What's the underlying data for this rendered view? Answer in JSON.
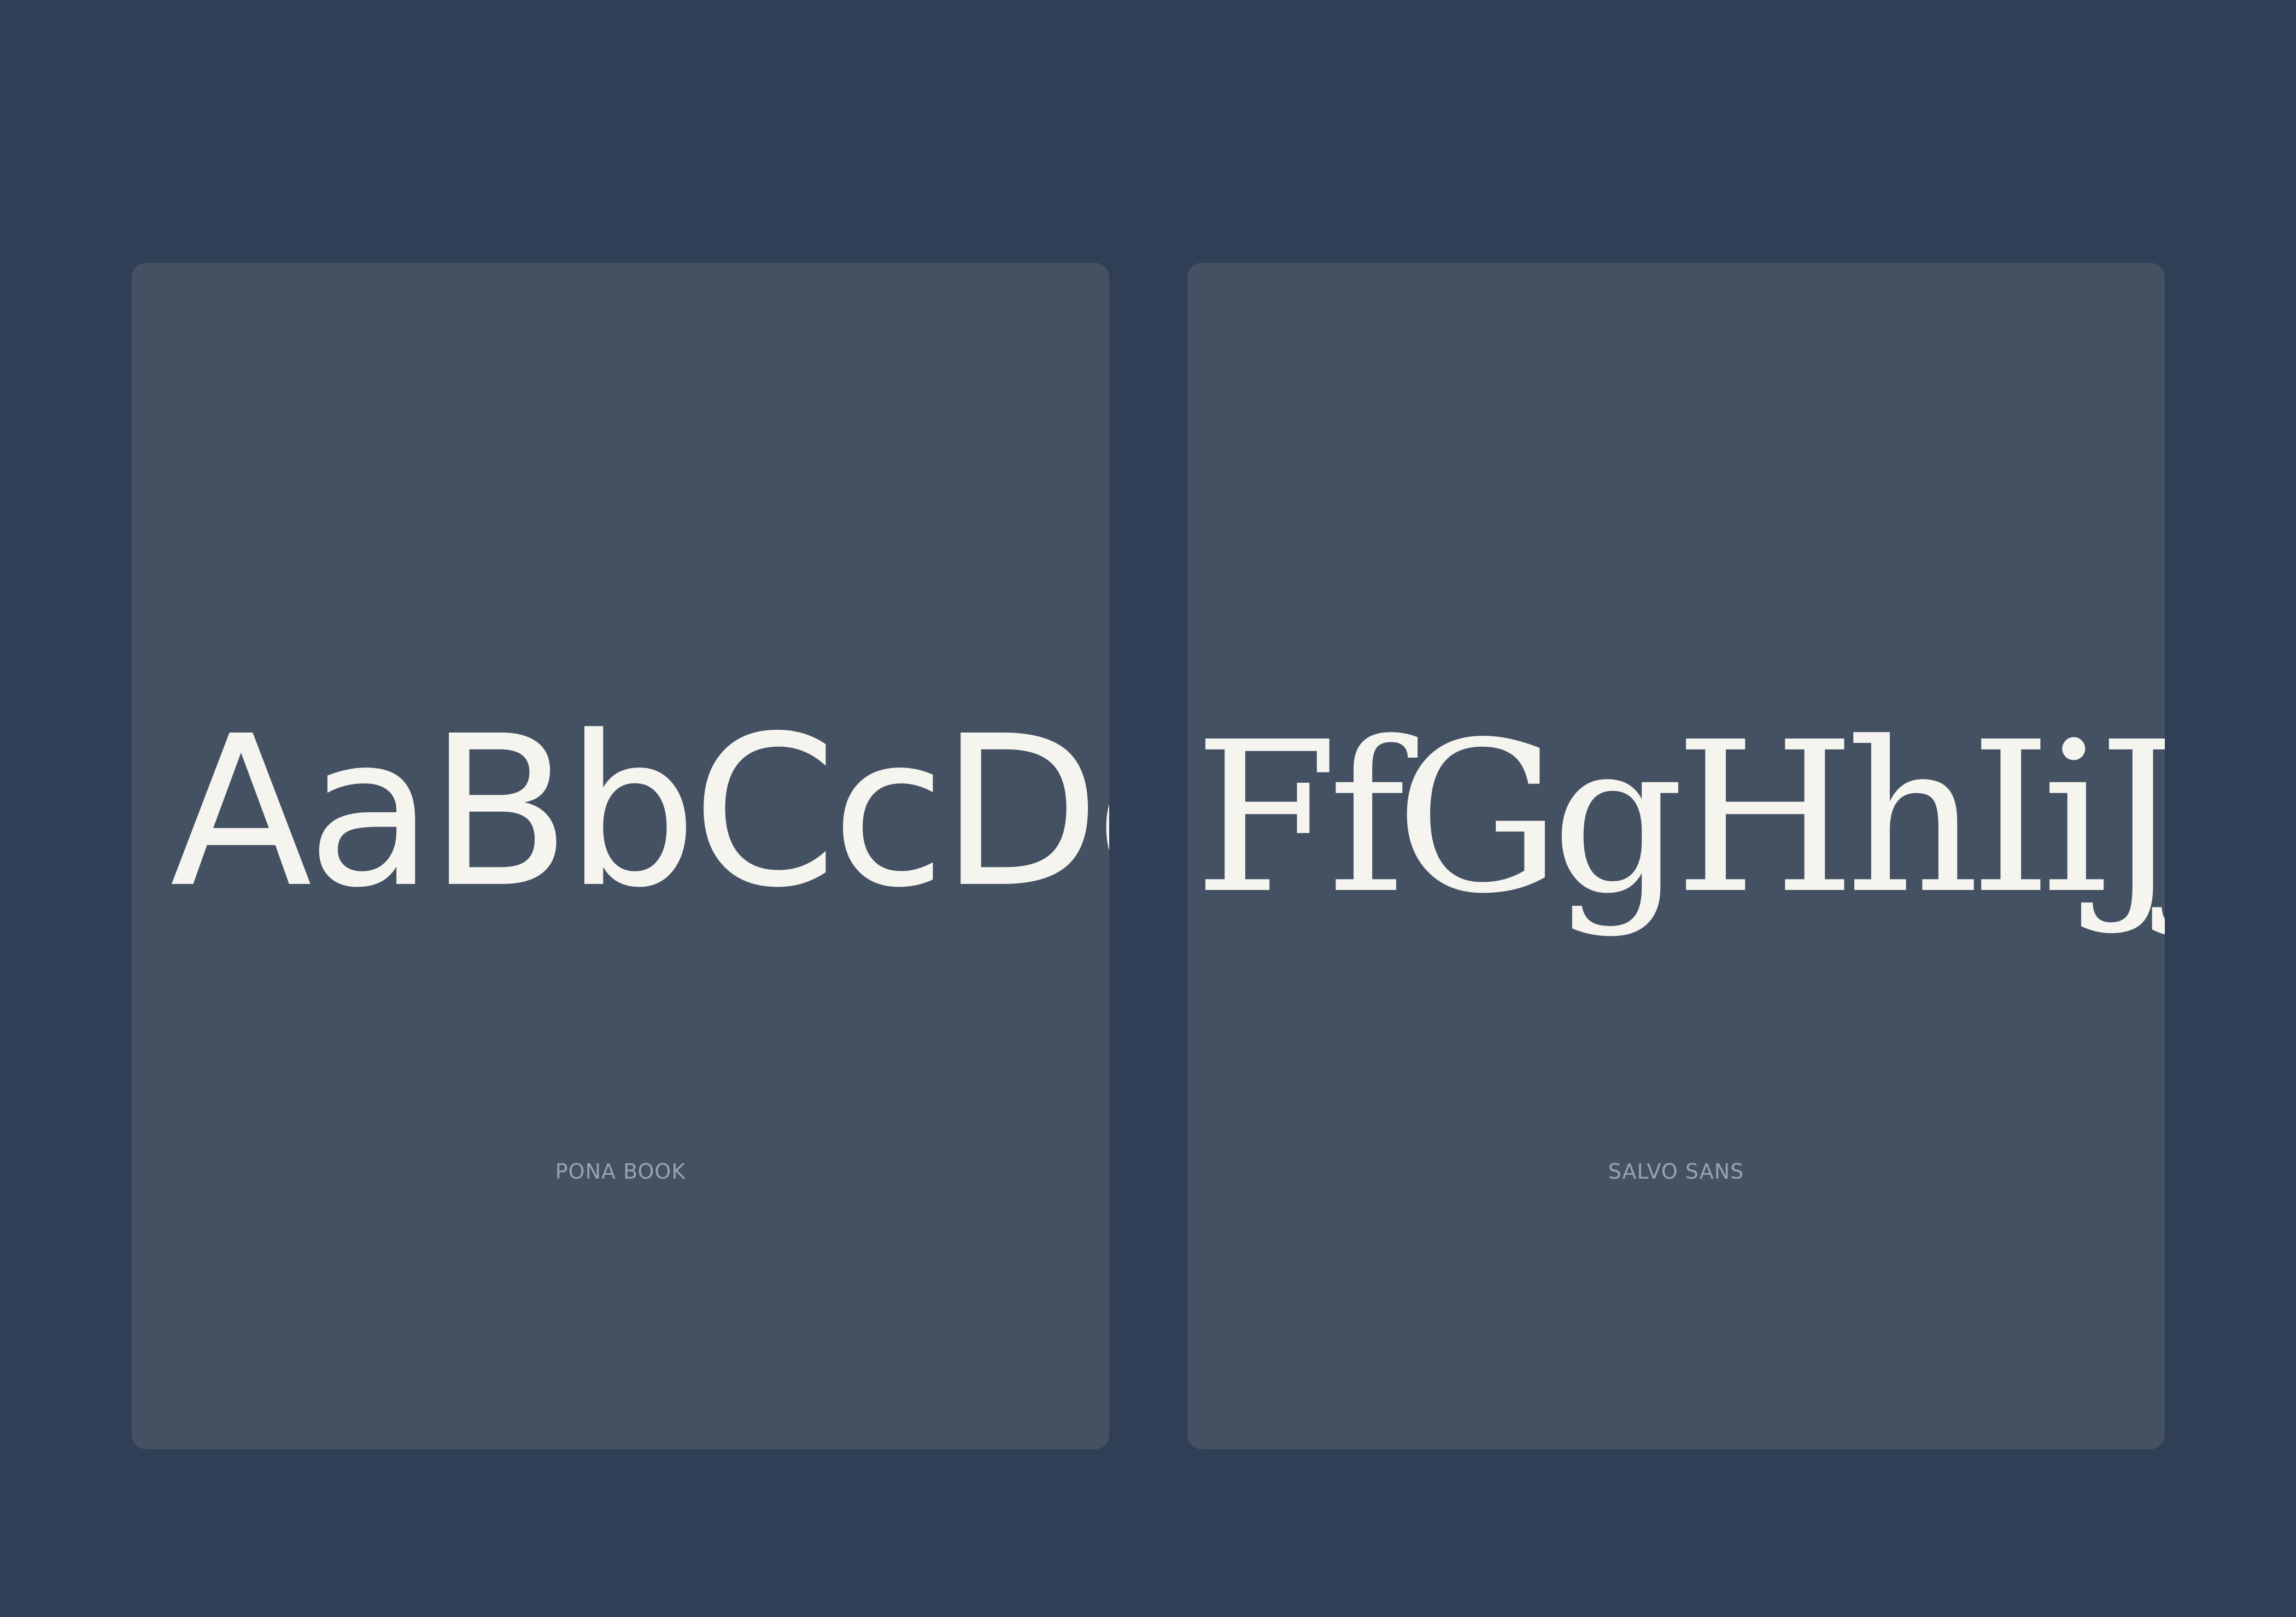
{
  "cards": [
    {
      "specimen": "AaBbCcDd",
      "label": "PONA BOOK"
    },
    {
      "specimen": "FfGgHhIiJjKk",
      "label": "SALVO SANS"
    }
  ],
  "colors": {
    "background": "#313f56",
    "card": "#435163",
    "specimen_text": "#f6f4ef",
    "label_text": "#9aa2ad"
  }
}
